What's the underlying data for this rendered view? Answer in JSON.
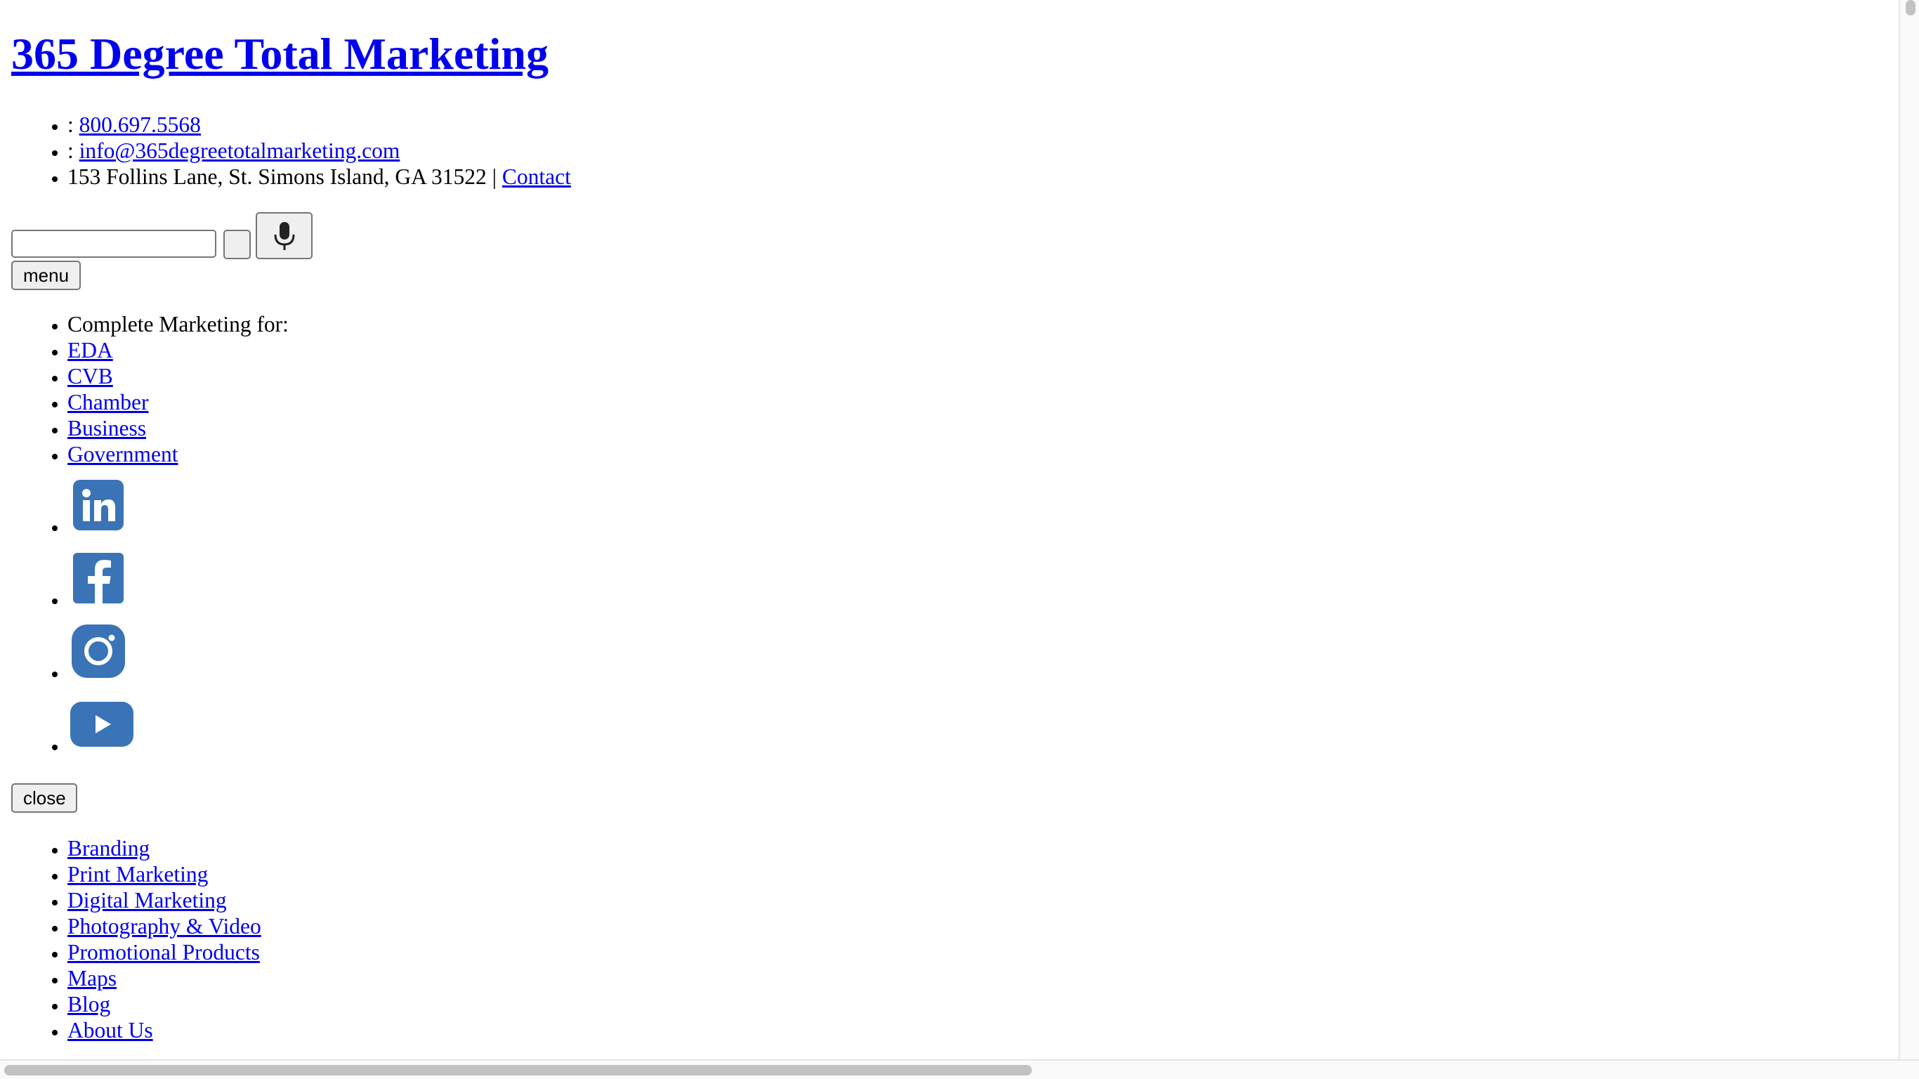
{
  "header": {
    "site_title": "365 Degree Total Marketing"
  },
  "contact": {
    "phone_prefix": ": ",
    "phone": "800.697.5568",
    "email_prefix": ": ",
    "email": "info@365degreetotalmarketing.com",
    "address": "153 Follins Lane, St. Simons Island, GA 31522 | ",
    "contact_link": "Contact"
  },
  "search": {
    "input_value": "",
    "submit_label": "",
    "mic_icon": "microphone-icon"
  },
  "menu": {
    "open_label": "menu",
    "close_label": "close"
  },
  "audiences": {
    "heading": "Complete Marketing for:",
    "items": [
      "EDA",
      "CVB",
      "Chamber",
      "Business",
      "Government"
    ]
  },
  "social": {
    "items": [
      {
        "icon": "linkedin-icon",
        "color": "#3a74b6"
      },
      {
        "icon": "facebook-icon",
        "color": "#3a74b6"
      },
      {
        "icon": "instagram-icon",
        "color": "#3a74b6"
      },
      {
        "icon": "youtube-icon",
        "color": "#3a74b6"
      }
    ]
  },
  "services": {
    "items": [
      "Branding",
      "Print Marketing",
      "Digital Marketing",
      "Photography & Video",
      "Promotional Products",
      "Maps",
      "Blog",
      "About Us"
    ]
  },
  "colors": {
    "link": "#0000ee",
    "social_icon": "#3a74b6",
    "button_bg": "#efefef"
  }
}
